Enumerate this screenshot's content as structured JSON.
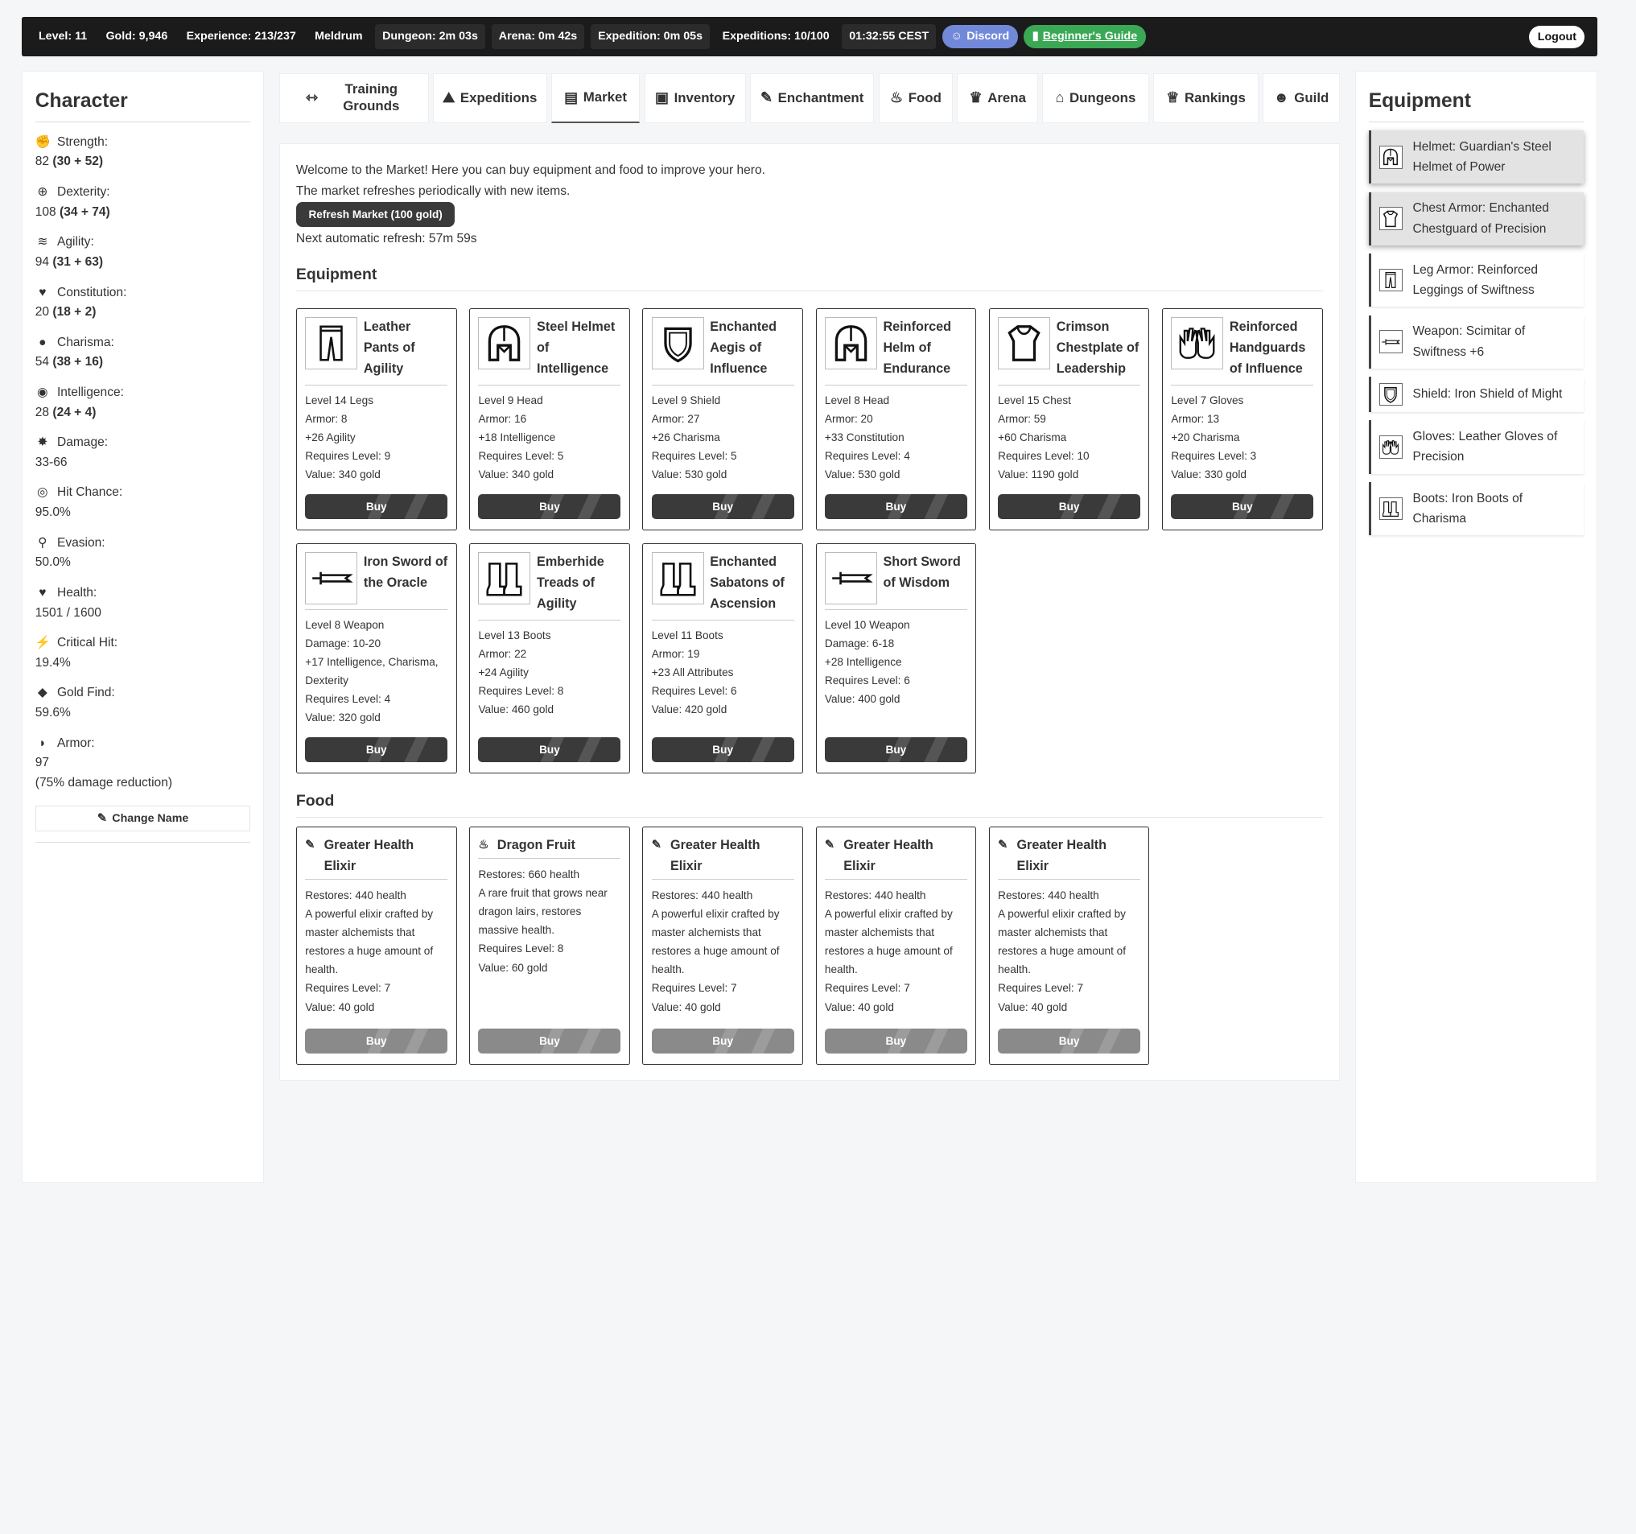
{
  "topbar": {
    "level": "Level: 11",
    "gold": "Gold: 9,946",
    "experience": "Experience: 213/237",
    "location": "Meldrum",
    "dungeon": "Dungeon: 2m 03s",
    "arena": "Arena: 0m 42s",
    "expedition": "Expedition: 0m 05s",
    "expeditions": "Expeditions: 10/100",
    "time": "01:32:55 CEST",
    "discord": "Discord",
    "guide": "Beginner's Guide",
    "logout": "Logout"
  },
  "character": {
    "title": "Character",
    "stats": [
      {
        "label": "Strength:",
        "value": "82",
        "extra": "(30 + 52)",
        "icon": "fist-icon"
      },
      {
        "label": "Dexterity:",
        "value": "108",
        "extra": "(34 + 74)",
        "icon": "crosshair-icon"
      },
      {
        "label": "Agility:",
        "value": "94",
        "extra": "(31 + 63)",
        "icon": "wind-icon"
      },
      {
        "label": "Constitution:",
        "value": "20",
        "extra": "(18 + 2)",
        "icon": "heartbeat-icon"
      },
      {
        "label": "Charisma:",
        "value": "54",
        "extra": "(38 + 16)",
        "icon": "comment-icon"
      },
      {
        "label": "Intelligence:",
        "value": "28",
        "extra": "(24 + 4)",
        "icon": "brain-icon"
      },
      {
        "label": "Damage:",
        "value": "33-66",
        "extra": "",
        "icon": "damage-icon"
      },
      {
        "label": "Hit Chance:",
        "value": "95.0%",
        "extra": "",
        "icon": "target-icon"
      },
      {
        "label": "Evasion:",
        "value": "50.0%",
        "extra": "",
        "icon": "running-icon"
      },
      {
        "label": "Health:",
        "value": "1501 / 1600",
        "extra": "",
        "icon": "heart-icon"
      },
      {
        "label": "Critical Hit:",
        "value": "19.4%",
        "extra": "",
        "icon": "bolt-icon"
      },
      {
        "label": "Gold Find:",
        "value": "59.6%",
        "extra": "",
        "icon": "gem-icon"
      },
      {
        "label": "Armor:",
        "value": "97",
        "extra": "",
        "icon": "shield-icon"
      }
    ],
    "armor_note": "(75% damage reduction)",
    "change_name": "Change Name"
  },
  "tabs": [
    {
      "label": "Training Grounds",
      "icon": "dumbbell-icon",
      "glyph": "⇿"
    },
    {
      "label": "Expeditions",
      "icon": "hiking-icon",
      "glyph": "⛰"
    },
    {
      "label": "Market",
      "icon": "store-icon",
      "glyph": "▤"
    },
    {
      "label": "Inventory",
      "icon": "box-icon",
      "glyph": "▣"
    },
    {
      "label": "Enchantment",
      "icon": "wand-icon",
      "glyph": "✎"
    },
    {
      "label": "Food",
      "icon": "drumstick-icon",
      "glyph": "♨"
    },
    {
      "label": "Arena",
      "icon": "trophy-icon",
      "glyph": "♛"
    },
    {
      "label": "Dungeons",
      "icon": "dungeon-icon",
      "glyph": "⌂"
    },
    {
      "label": "Rankings",
      "icon": "crown-icon",
      "glyph": "♕"
    },
    {
      "label": "Guild",
      "icon": "users-icon",
      "glyph": "☻"
    }
  ],
  "market": {
    "welcome1": "Welcome to the Market! Here you can buy equipment and food to improve your hero.",
    "welcome2": "The market refreshes periodically with new items.",
    "refresh_button": "Refresh Market (100 gold)",
    "next_refresh": "Next automatic refresh: 57m 59s",
    "equipment_title": "Equipment",
    "food_title": "Food",
    "buy_label": "Buy"
  },
  "equipment_items": [
    {
      "name": "Leather Pants of Agility",
      "icon": "pants-icon",
      "lines": [
        "Level 14 Legs",
        "Armor: 8",
        "+26 Agility",
        "Requires Level: 9",
        "Value: 340 gold"
      ]
    },
    {
      "name": "Steel Helmet of Intelligence",
      "icon": "helmet-icon",
      "lines": [
        "Level 9 Head",
        "Armor: 16",
        "+18 Intelligence",
        "Requires Level: 5",
        "Value: 340 gold"
      ]
    },
    {
      "name": "Enchanted Aegis of Influence",
      "icon": "shield-icon",
      "lines": [
        "Level 9 Shield",
        "Armor: 27",
        "+26 Charisma",
        "Requires Level: 5",
        "Value: 530 gold"
      ]
    },
    {
      "name": "Reinforced Helm of Endurance",
      "icon": "helmet-icon",
      "lines": [
        "Level 8 Head",
        "Armor: 20",
        "+33 Constitution",
        "Requires Level: 4",
        "Value: 530 gold"
      ]
    },
    {
      "name": "Crimson Chestplate of Leadership",
      "icon": "chestplate-icon",
      "lines": [
        "Level 15 Chest",
        "Armor: 59",
        "+60 Charisma",
        "Requires Level: 10",
        "Value: 1190 gold"
      ]
    },
    {
      "name": "Reinforced Handguards of Influence",
      "icon": "gloves-icon",
      "lines": [
        "Level 7 Gloves",
        "Armor: 13",
        "+20 Charisma",
        "Requires Level: 3",
        "Value: 330 gold"
      ]
    },
    {
      "name": "Iron Sword of the Oracle",
      "icon": "sword-icon",
      "lines": [
        "Level 8 Weapon",
        "Damage: 10-20",
        "+17 Intelligence, Charisma, Dexterity",
        "Requires Level: 4",
        "Value: 320 gold"
      ]
    },
    {
      "name": "Emberhide Treads of Agility",
      "icon": "boots-icon",
      "lines": [
        "Level 13 Boots",
        "Armor: 22",
        "+24 Agility",
        "Requires Level: 8",
        "Value: 460 gold"
      ]
    },
    {
      "name": "Enchanted Sabatons of Ascension",
      "icon": "boots-icon",
      "lines": [
        "Level 11 Boots",
        "Armor: 19",
        "+23 All Attributes",
        "Requires Level: 6",
        "Value: 420 gold"
      ]
    },
    {
      "name": "Short Sword of Wisdom",
      "icon": "sword-icon",
      "lines": [
        "Level 10 Weapon",
        "Damage: 6-18",
        "+28 Intelligence",
        "Requires Level: 6",
        "Value: 400 gold"
      ]
    }
  ],
  "food_items": [
    {
      "name": "Greater Health Elixir",
      "icon": "flask-icon",
      "glyph": "✎",
      "lines": [
        "Restores: 440 health",
        "A powerful elixir crafted by master alchemists that restores a huge amount of health.",
        "Requires Level: 7",
        "Value: 40 gold"
      ]
    },
    {
      "name": "Dragon Fruit",
      "icon": "fire-icon",
      "glyph": "♨",
      "lines": [
        "Restores: 660 health",
        "A rare fruit that grows near dragon lairs, restores massive health.",
        "Requires Level: 8",
        "Value: 60 gold"
      ]
    },
    {
      "name": "Greater Health Elixir",
      "icon": "flask-icon",
      "glyph": "✎",
      "lines": [
        "Restores: 440 health",
        "A powerful elixir crafted by master alchemists that restores a huge amount of health.",
        "Requires Level: 7",
        "Value: 40 gold"
      ]
    },
    {
      "name": "Greater Health Elixir",
      "icon": "flask-icon",
      "glyph": "✎",
      "lines": [
        "Restores: 440 health",
        "A powerful elixir crafted by master alchemists that restores a huge amount of health.",
        "Requires Level: 7",
        "Value: 40 gold"
      ]
    },
    {
      "name": "Greater Health Elixir",
      "icon": "flask-icon",
      "glyph": "✎",
      "lines": [
        "Restores: 440 health",
        "A powerful elixir crafted by master alchemists that restores a huge amount of health.",
        "Requires Level: 7",
        "Value: 40 gold"
      ]
    }
  ],
  "equipped": {
    "title": "Equipment",
    "items": [
      {
        "text": "Helmet: Guardian's Steel Helmet of Power",
        "icon": "helmet-icon",
        "highlighted": true
      },
      {
        "text": "Chest Armor: Enchanted Chestguard of Precision",
        "icon": "chestplate-icon",
        "highlighted": true
      },
      {
        "text": "Leg Armor: Reinforced Leggings of Swiftness",
        "icon": "pants-icon",
        "highlighted": false
      },
      {
        "text": "Weapon: Scimitar of Swiftness +6",
        "icon": "sword-icon",
        "highlighted": false
      },
      {
        "text": "Shield: Iron Shield of Might",
        "icon": "shield-icon",
        "highlighted": false
      },
      {
        "text": "Gloves: Leather Gloves of Precision",
        "icon": "gloves-icon",
        "highlighted": false
      },
      {
        "text": "Boots: Iron Boots of Charisma",
        "icon": "boots-icon",
        "highlighted": false
      }
    ]
  }
}
